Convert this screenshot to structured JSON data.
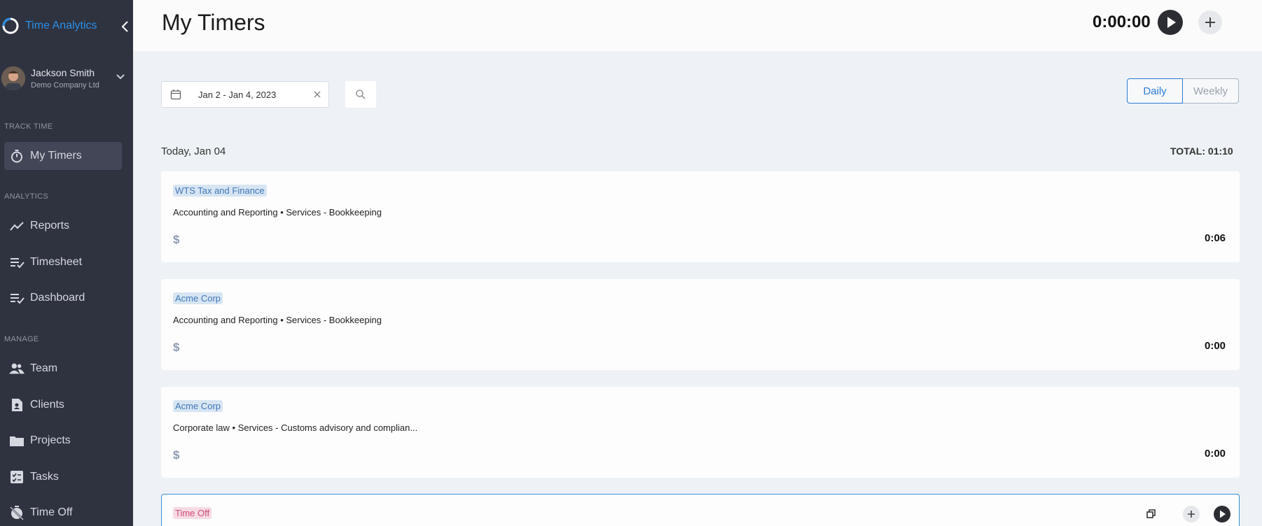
{
  "app": {
    "brand": "Time Analytics"
  },
  "user": {
    "name": "Jackson Smith",
    "company": "Demo Company Ltd"
  },
  "sidebar": {
    "sections": {
      "track": "TRACK TIME",
      "analytics": "ANALYTICS",
      "manage": "MANAGE"
    },
    "items": [
      {
        "label": "My Timers",
        "icon": "stopwatch-icon"
      },
      {
        "label": "Reports",
        "icon": "trend-icon"
      },
      {
        "label": "Timesheet",
        "icon": "list-check-icon"
      },
      {
        "label": "Dashboard",
        "icon": "list-check-icon"
      },
      {
        "label": "Team",
        "icon": "people-icon"
      },
      {
        "label": "Clients",
        "icon": "contact-icon"
      },
      {
        "label": "Projects",
        "icon": "folder-icon"
      },
      {
        "label": "Tasks",
        "icon": "checklist-icon"
      },
      {
        "label": "Time Off",
        "icon": "no-timer-icon"
      }
    ]
  },
  "header": {
    "title": "My Timers",
    "timer": "0:00:00"
  },
  "toolbar": {
    "date_range": "Jan 2 - Jan 4, 2023",
    "view_daily": "Daily",
    "view_weekly": "Weekly",
    "selected_view": "Daily"
  },
  "day": {
    "label": "Today, Jan 04",
    "total": "TOTAL: 01:10"
  },
  "entries": [
    {
      "client": "WTS Tax and Finance",
      "task": "Accounting and Reporting • Services - Bookkeeping",
      "billable": "$",
      "duration": "0:06"
    },
    {
      "client": "Acme Corp",
      "task": "Accounting and Reporting • Services - Bookkeeping",
      "billable": "$",
      "duration": "0:00"
    },
    {
      "client": "Acme Corp",
      "task": "Corporate law • Services - Customs advisory and complian...",
      "billable": "$",
      "duration": "0:00"
    }
  ],
  "timeoff_entry": {
    "client": "Time Off"
  },
  "colors": {
    "sidebar_bg": "#2f3340",
    "accent": "#2a8fe6",
    "timeoff": "#d24a7c"
  }
}
